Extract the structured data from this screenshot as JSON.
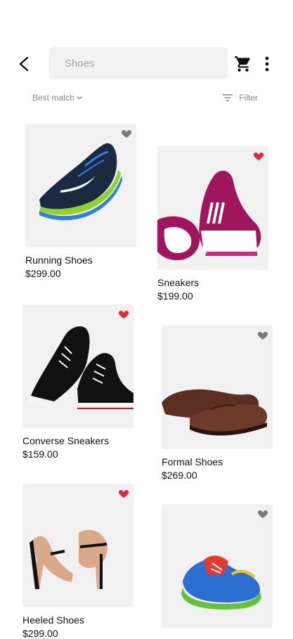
{
  "search": {
    "placeholder": "Shoes",
    "value": ""
  },
  "sort": {
    "label": "Best match"
  },
  "filter": {
    "label": "Filter"
  },
  "colors": {
    "favorite_active": "#e0283c",
    "favorite_inactive": "#7a7a7a",
    "card_bg": "#f1f1f1"
  },
  "products": [
    {
      "name": "Running Shoes",
      "price": "$299.00",
      "favorite": false
    },
    {
      "name": "Sneakers",
      "price": "$199.00",
      "favorite": true
    },
    {
      "name": "Converse Sneakers",
      "price": "$159.00",
      "favorite": true
    },
    {
      "name": "Formal Shoes",
      "price": "$269.00",
      "favorite": false
    },
    {
      "name": "Heeled Shoes",
      "price": "$299.00",
      "favorite": true
    },
    {
      "name": "",
      "price": "",
      "favorite": false
    }
  ]
}
